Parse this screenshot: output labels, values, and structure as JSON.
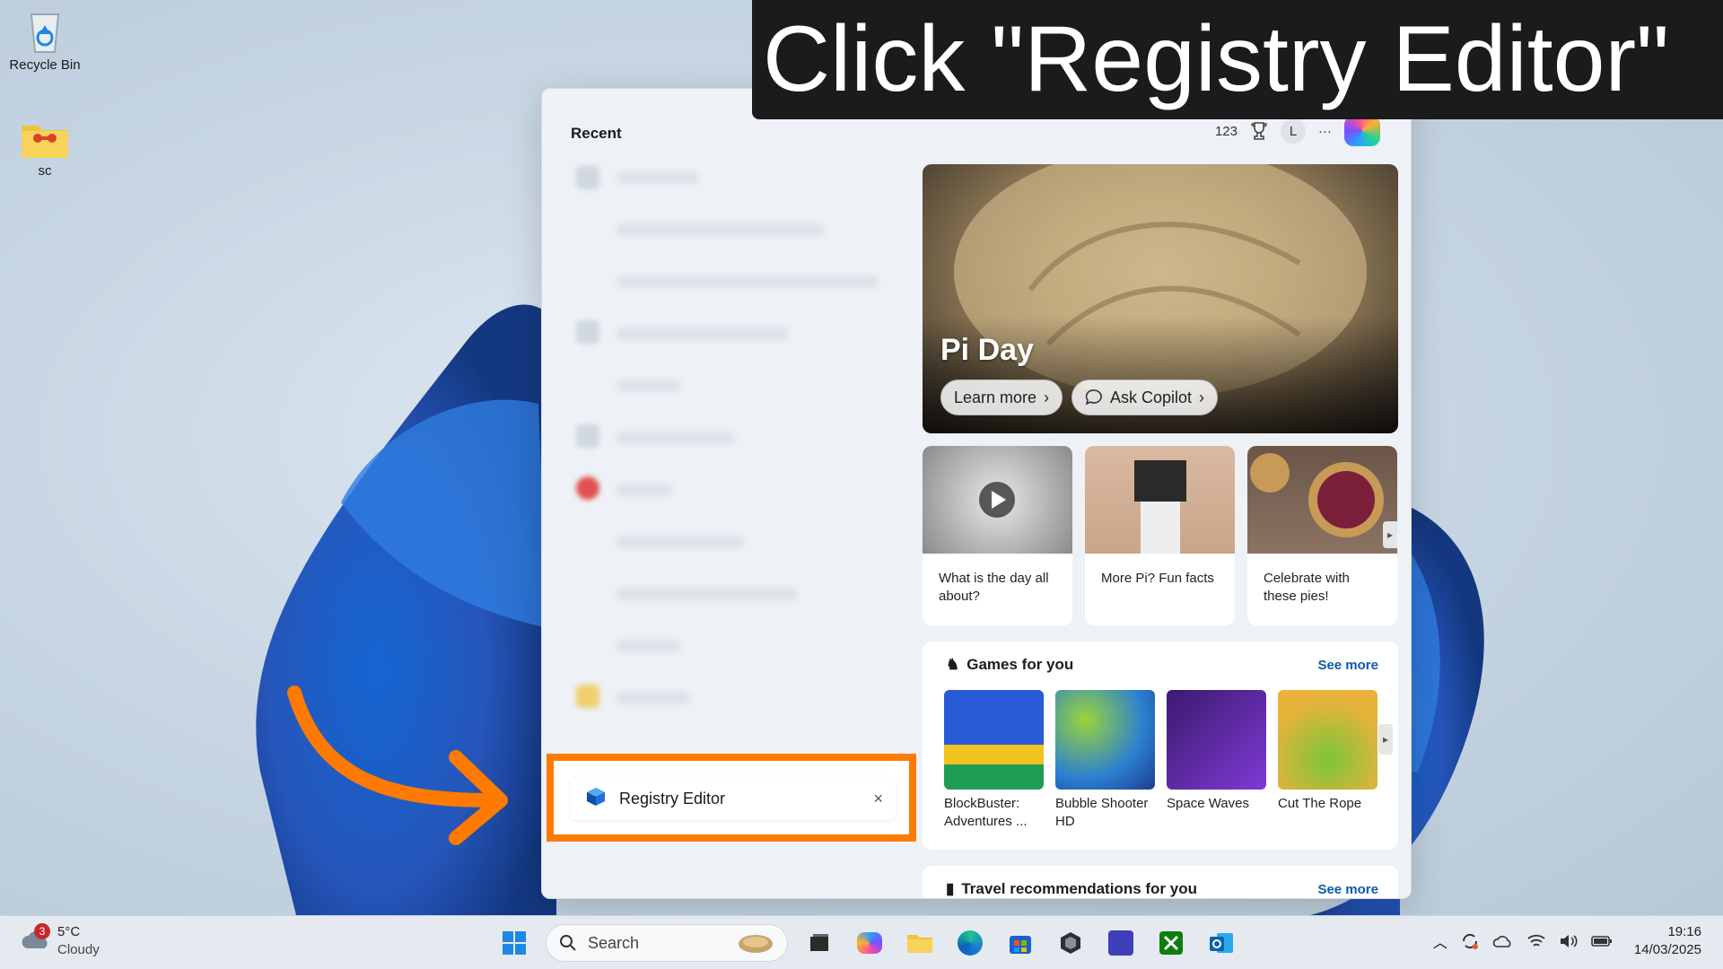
{
  "banner": {
    "text": "Click \"Registry Editor\""
  },
  "desktop": {
    "icons": [
      {
        "label": "Recycle Bin",
        "icon": "recycle-bin-icon"
      },
      {
        "label": "sc",
        "icon": "folder-icon"
      }
    ]
  },
  "panel": {
    "recent_title": "Recent",
    "topbar": {
      "points": "123",
      "avatar_letter": "L",
      "more": "···"
    },
    "hero": {
      "title": "Pi Day",
      "learn_more": "Learn more",
      "ask_copilot": "Ask Copilot"
    },
    "cards": [
      {
        "caption": "What is the day all about?"
      },
      {
        "caption": "More Pi? Fun facts"
      },
      {
        "caption": "Celebrate with these pies!"
      }
    ],
    "games": {
      "title": "Games for you",
      "see_more": "See more",
      "items": [
        {
          "name": "BlockBuster: Adventures ..."
        },
        {
          "name": "Bubble Shooter HD"
        },
        {
          "name": "Space Waves"
        },
        {
          "name": "Cut The Rope"
        }
      ]
    },
    "travel": {
      "title": "Travel recommendations for you",
      "see_more": "See more"
    },
    "search_result": {
      "label": "Registry Editor",
      "close": "×"
    }
  },
  "taskbar": {
    "weather": {
      "badge": "3",
      "temp": "5°C",
      "condition": "Cloudy"
    },
    "search_placeholder": "Search",
    "clock": {
      "time": "19:16",
      "date": "14/03/2025"
    }
  },
  "colors": {
    "highlight": "#ff7a00",
    "banner_bg": "#1b1b1b",
    "link": "#0f5ba8"
  }
}
